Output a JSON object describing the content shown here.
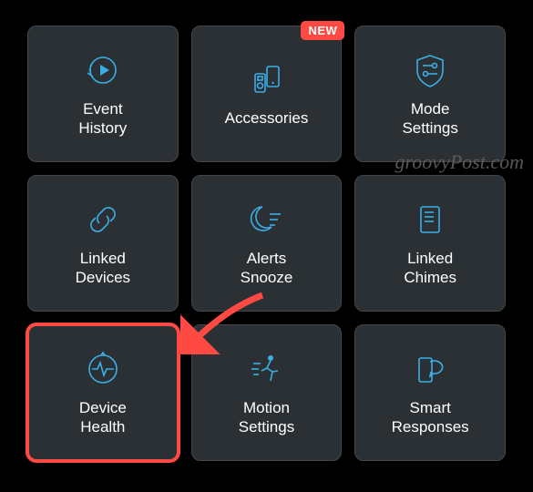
{
  "accent_color": "#3baee6",
  "badge_color": "#ff4a43",
  "watermark": "groovyPost.com",
  "tiles": [
    {
      "id": "event-history",
      "label": "Event\nHistory",
      "icon": "replay-play-icon"
    },
    {
      "id": "accessories",
      "label": "Accessories",
      "icon": "devices-icon",
      "badge": "NEW"
    },
    {
      "id": "mode-settings",
      "label": "Mode\nSettings",
      "icon": "shield-toggles-icon"
    },
    {
      "id": "linked-devices",
      "label": "Linked\nDevices",
      "icon": "link-icon"
    },
    {
      "id": "alerts-snooze",
      "label": "Alerts\nSnooze",
      "icon": "moon-snooze-icon"
    },
    {
      "id": "linked-chimes",
      "label": "Linked\nChimes",
      "icon": "document-lines-icon"
    },
    {
      "id": "device-health",
      "label": "Device\nHealth",
      "icon": "health-pulse-icon",
      "highlighted": true
    },
    {
      "id": "motion-settings",
      "label": "Motion\nSettings",
      "icon": "running-person-icon"
    },
    {
      "id": "smart-responses",
      "label": "Smart\nResponses",
      "icon": "chat-phone-icon"
    }
  ]
}
